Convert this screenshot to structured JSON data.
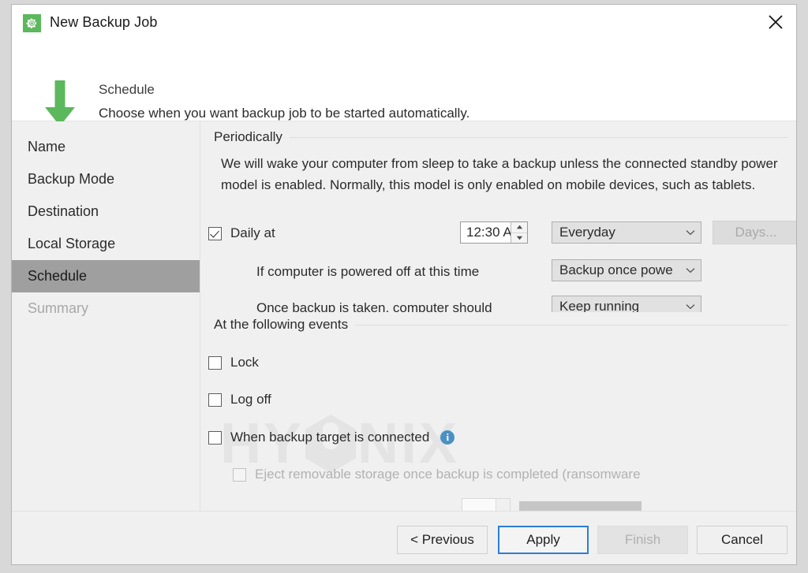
{
  "window": {
    "title": "New Backup Job",
    "app_icon": "gear-icon",
    "close_icon": "close-icon",
    "accent_green": "#5cb85c",
    "accent_blue": "#2a7fd4"
  },
  "header": {
    "icon": "backup-download-to-drive-icon",
    "title": "Schedule",
    "subtitle": "Choose when you want backup job to be started automatically."
  },
  "sidebar": {
    "items": [
      {
        "label": "Name",
        "state": "normal"
      },
      {
        "label": "Backup Mode",
        "state": "normal"
      },
      {
        "label": "Destination",
        "state": "normal"
      },
      {
        "label": "Local Storage",
        "state": "normal"
      },
      {
        "label": "Schedule",
        "state": "selected"
      },
      {
        "label": "Summary",
        "state": "disabled"
      }
    ]
  },
  "periodically": {
    "group_label": "Periodically",
    "description": "We will wake your computer from sleep to take a backup unless the connected standby power model is enabled. Normally, this model is only enabled on mobile devices, such as tablets.",
    "daily": {
      "label": "Daily at",
      "checked": true,
      "time_value": "12:30 A",
      "frequency_value": "Everyday",
      "days_button": "Days...",
      "days_button_enabled": false
    },
    "powered_off": {
      "label": "If computer is powered off at this time",
      "value": "Backup once powe"
    },
    "after_backup": {
      "label": "Once backup is taken, computer should",
      "value": "Keep running"
    }
  },
  "events": {
    "group_label": "At the following events",
    "items": [
      {
        "label": "Lock",
        "checked": false,
        "disabled": false,
        "info": false
      },
      {
        "label": "Log off",
        "checked": false,
        "disabled": false,
        "info": false
      },
      {
        "label": "When backup target is connected",
        "checked": false,
        "disabled": false,
        "info": true
      },
      {
        "label": "Eject removable storage once backup is completed (ransomware",
        "checked": false,
        "disabled": true,
        "info": false
      }
    ],
    "info_icon_glyph": "i"
  },
  "watermark": {
    "text_before": "HY",
    "text_after": "NIX"
  },
  "footer": {
    "previous": "< Previous",
    "apply": "Apply",
    "finish": "Finish",
    "cancel": "Cancel"
  }
}
